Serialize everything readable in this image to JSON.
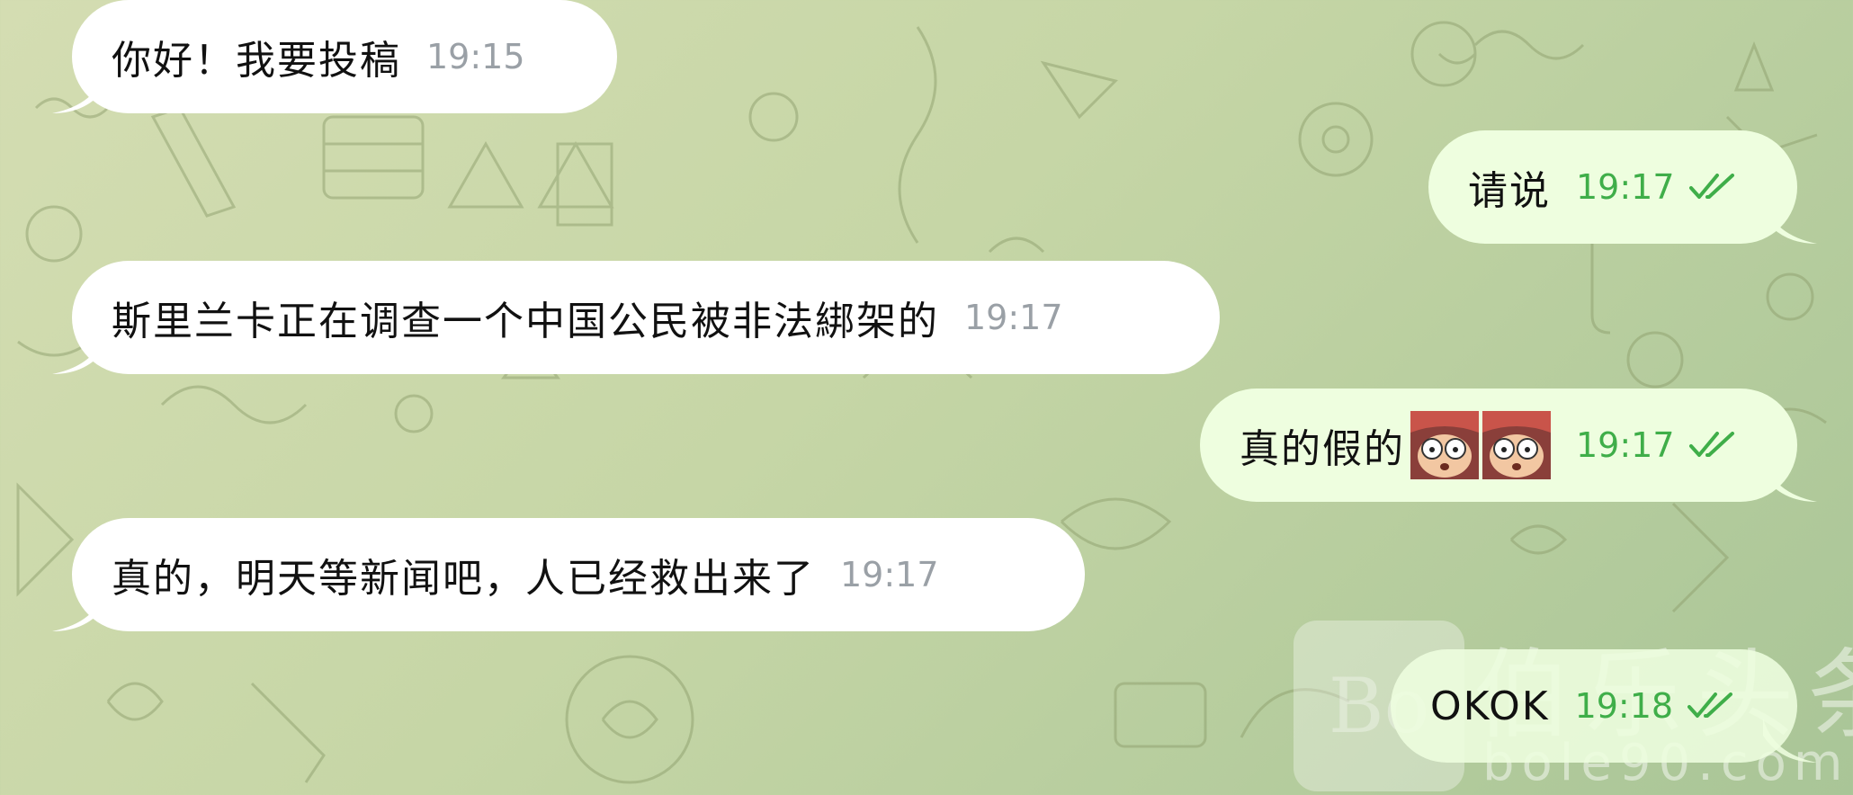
{
  "theme": {
    "incoming_bubble": "#ffffff",
    "outgoing_bubble": "#eefedf",
    "outgoing_time": "#3fae49",
    "incoming_time": "#9aa0a6"
  },
  "messages": [
    {
      "direction": "in",
      "text": "你好！我要投稿",
      "time": "19:15"
    },
    {
      "direction": "out",
      "text": "请说",
      "time": "19:17",
      "status": "read-double-check-icon"
    },
    {
      "direction": "in",
      "text": "斯里兰卡正在调查一个中国公民被非法綁架的",
      "time": "19:17"
    },
    {
      "direction": "out",
      "text": "真的假的",
      "time": "19:17",
      "status": "read-double-check-icon",
      "stickers": [
        "shocked-face-emoji",
        "shocked-face-emoji"
      ]
    },
    {
      "direction": "in",
      "text": "真的，明天等新闻吧，人已经救出来了",
      "time": "19:17"
    },
    {
      "direction": "out",
      "text": "OKOK",
      "time": "19:18",
      "status": "read-double-check-icon"
    }
  ],
  "watermark": {
    "logo": "Bo",
    "name": "伯乐头条",
    "url": "bole90.com"
  }
}
